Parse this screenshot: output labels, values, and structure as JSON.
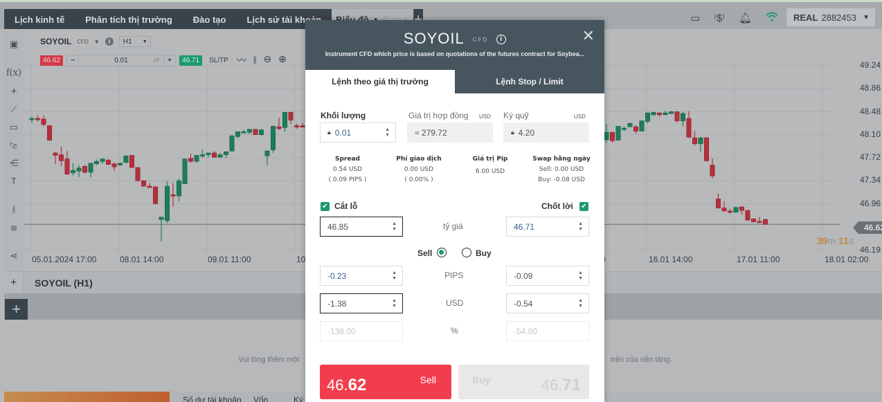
{
  "nav": {
    "tabs": [
      "Lịch kinh tế",
      "Phân tích thị trường",
      "Đào tạo",
      "Lịch sử tài khoản"
    ],
    "active_tab": "Biểu đồ",
    "active_tab_controls": "⧉ ▭ ×",
    "add_tab": "+"
  },
  "topbar": {
    "icons": [
      "layout-icon",
      "price-alert-icon",
      "bell-icon",
      "wifi-icon"
    ],
    "account_type": "REAL",
    "account_number": "2882453",
    "wifi_color": "#1d9a6c"
  },
  "chart_header": {
    "symbol": "SOYOIL",
    "symbol_type": "CFD",
    "timeframe": "H1",
    "sell_price": "46.62",
    "buy_price": "46.71",
    "volume": "0.01",
    "sltp_label": "SL/TP",
    "sell_color": "#d23a46",
    "buy_color": "#1d9a6c"
  },
  "chart_data": {
    "type": "candlestick",
    "symbol": "SOYOIL",
    "timeframe": "H1",
    "ylim": [
      46.0,
      49.4
    ],
    "yticks": [
      "49.24",
      "48.86",
      "48.48",
      "48.10",
      "47.72",
      "47.34",
      "46.96",
      "46.19"
    ],
    "current_price": "46.62",
    "countdown": {
      "minutes": "39",
      "m": "m",
      "seconds": "11",
      "s": "s"
    },
    "xticks": [
      {
        "label": "05.01.2024 17:00",
        "bar": 0
      },
      {
        "label": "08.01 14:00",
        "bar": 14
      },
      {
        "label": "09.01 11:00",
        "bar": 29
      },
      {
        "label": "10",
        "bar": 44
      },
      {
        "label": "0",
        "bar": 94
      },
      {
        "label": "16.01 14:00",
        "bar": 104
      },
      {
        "label": "17.01 11:00",
        "bar": 120
      },
      {
        "label": "18.01 02:00",
        "bar": 135
      }
    ],
    "candles_left": [
      {
        "o": 48.35,
        "h": 48.4,
        "l": 48.3,
        "c": 48.37
      },
      {
        "o": 48.37,
        "h": 48.42,
        "l": 48.32,
        "c": 48.35
      },
      {
        "o": 48.36,
        "h": 48.42,
        "l": 48.24,
        "c": 48.27
      },
      {
        "o": 48.25,
        "h": 48.26,
        "l": 48.0,
        "c": 48.01
      },
      {
        "o": 47.8,
        "h": 47.82,
        "l": 47.62,
        "c": 47.76
      },
      {
        "o": 47.77,
        "h": 47.9,
        "l": 47.58,
        "c": 47.67
      },
      {
        "o": 47.7,
        "h": 47.83,
        "l": 47.44,
        "c": 47.45
      },
      {
        "o": 47.47,
        "h": 47.63,
        "l": 47.43,
        "c": 47.51
      },
      {
        "o": 47.5,
        "h": 47.6,
        "l": 47.4,
        "c": 47.55
      },
      {
        "o": 47.58,
        "h": 47.6,
        "l": 47.46,
        "c": 47.48
      },
      {
        "o": 47.48,
        "h": 47.62,
        "l": 47.4,
        "c": 47.63
      },
      {
        "o": 47.62,
        "h": 47.69,
        "l": 47.6,
        "c": 47.66
      },
      {
        "o": 47.66,
        "h": 47.71,
        "l": 47.62,
        "c": 47.7
      },
      {
        "o": 47.68,
        "h": 47.7,
        "l": 47.6,
        "c": 47.61
      },
      {
        "o": 47.62,
        "h": 47.64,
        "l": 47.5,
        "c": 47.57
      },
      {
        "o": 47.6,
        "h": 47.64,
        "l": 47.58,
        "c": 47.63
      },
      {
        "o": 47.64,
        "h": 47.76,
        "l": 47.64,
        "c": 47.75
      },
      {
        "o": 47.76,
        "h": 47.76,
        "l": 47.55,
        "c": 47.56
      },
      {
        "o": 47.56,
        "h": 47.56,
        "l": 47.33,
        "c": 47.34
      },
      {
        "o": 47.34,
        "h": 47.35,
        "l": 47.25,
        "c": 47.25
      },
      {
        "o": 47.25,
        "h": 47.3,
        "l": 47.23,
        "c": 47.24
      },
      {
        "o": 47.24,
        "h": 47.25,
        "l": 46.95,
        "c": 46.96
      },
      {
        "o": 46.7,
        "h": 46.73,
        "l": 46.34,
        "c": 46.74
      },
      {
        "o": 46.68,
        "h": 47.33,
        "l": 46.64,
        "c": 47.25
      },
      {
        "o": 47.11,
        "h": 47.3,
        "l": 46.91,
        "c": 47.09
      },
      {
        "o": 47.09,
        "h": 47.38,
        "l": 47.0,
        "c": 47.34
      },
      {
        "o": 47.29,
        "h": 47.71,
        "l": 47.29,
        "c": 47.7
      },
      {
        "o": 47.71,
        "h": 47.79,
        "l": 47.64,
        "c": 47.66
      },
      {
        "o": 47.66,
        "h": 47.76,
        "l": 47.64,
        "c": 47.76
      },
      {
        "o": 47.75,
        "h": 47.85,
        "l": 47.72,
        "c": 47.77
      },
      {
        "o": 47.77,
        "h": 47.79,
        "l": 47.73,
        "c": 47.8
      },
      {
        "o": 47.8,
        "h": 47.83,
        "l": 47.72,
        "c": 47.73
      },
      {
        "o": 47.73,
        "h": 47.8,
        "l": 47.72,
        "c": 47.77
      },
      {
        "o": 47.77,
        "h": 47.79,
        "l": 47.72,
        "c": 47.82
      },
      {
        "o": 47.83,
        "h": 48.1,
        "l": 47.82,
        "c": 48.08
      },
      {
        "o": 48.07,
        "h": 48.15,
        "l": 48.04,
        "c": 48.15
      },
      {
        "o": 48.13,
        "h": 48.18,
        "l": 48.13,
        "c": 48.15
      },
      {
        "o": 48.14,
        "h": 48.19,
        "l": 48.11,
        "c": 48.19
      },
      {
        "o": 48.19,
        "h": 48.19,
        "l": 48.1,
        "c": 48.1
      },
      {
        "o": 48.1,
        "h": 48.2,
        "l": 48.09,
        "c": 48.18
      },
      {
        "o": 47.75,
        "h": 47.85,
        "l": 47.6,
        "c": 47.83
      },
      {
        "o": 47.85,
        "h": 48.25,
        "l": 47.8,
        "c": 48.24
      },
      {
        "o": 48.23,
        "h": 48.38,
        "l": 48.18,
        "c": 48.2
      },
      {
        "o": 48.22,
        "h": 48.47,
        "l": 48.15,
        "c": 48.47
      },
      {
        "o": 48.47,
        "h": 48.48,
        "l": 48.28,
        "c": 48.34
      },
      {
        "o": 48.25,
        "h": 48.28,
        "l": 48.2,
        "c": 48.23
      },
      {
        "o": 48.25,
        "h": 48.3,
        "l": 48.22,
        "c": 48.23
      }
    ],
    "candles_right": [
      {
        "o": 48.02,
        "h": 48.28,
        "l": 47.97,
        "c": 48.14
      },
      {
        "o": 48.14,
        "h": 48.15,
        "l": 47.97,
        "c": 48.0
      },
      {
        "o": 48.01,
        "h": 48.23,
        "l": 48.01,
        "c": 48.24
      },
      {
        "o": 48.19,
        "h": 48.23,
        "l": 48.16,
        "c": 48.21
      },
      {
        "o": 48.23,
        "h": 48.27,
        "l": 48.23,
        "c": 48.29
      },
      {
        "o": 48.23,
        "h": 48.26,
        "l": 48.12,
        "c": 48.16
      },
      {
        "o": 48.16,
        "h": 48.3,
        "l": 48.16,
        "c": 48.33
      },
      {
        "o": 48.32,
        "h": 48.47,
        "l": 48.29,
        "c": 48.46
      },
      {
        "o": 48.43,
        "h": 48.48,
        "l": 48.41,
        "c": 48.47
      },
      {
        "o": 48.46,
        "h": 48.47,
        "l": 48.4,
        "c": 48.43
      },
      {
        "o": 48.43,
        "h": 48.5,
        "l": 48.43,
        "c": 48.46
      },
      {
        "o": 48.45,
        "h": 48.49,
        "l": 48.45,
        "c": 48.48
      },
      {
        "o": 48.48,
        "h": 48.49,
        "l": 48.3,
        "c": 48.33
      },
      {
        "o": 48.33,
        "h": 48.48,
        "l": 48.24,
        "c": 48.45
      },
      {
        "o": 48.37,
        "h": 48.49,
        "l": 48.05,
        "c": 48.06
      },
      {
        "o": 48.05,
        "h": 48.16,
        "l": 47.92,
        "c": 47.95
      },
      {
        "o": 47.95,
        "h": 48.06,
        "l": 47.82,
        "c": 48.05
      },
      {
        "o": 48.05,
        "h": 48.06,
        "l": 47.66,
        "c": 47.67
      },
      {
        "o": 47.6,
        "h": 47.71,
        "l": 47.38,
        "c": 47.42
      },
      {
        "o": 47.04,
        "h": 47.13,
        "l": 46.88,
        "c": 46.89
      },
      {
        "o": 46.89,
        "h": 47.0,
        "l": 46.83,
        "c": 46.84
      },
      {
        "o": 46.84,
        "h": 46.88,
        "l": 46.8,
        "c": 46.82
      },
      {
        "o": 46.82,
        "h": 46.91,
        "l": 46.82,
        "c": 46.9
      },
      {
        "o": 46.91,
        "h": 46.91,
        "l": 46.78,
        "c": 46.85
      },
      {
        "o": 46.85,
        "h": 46.86,
        "l": 46.69,
        "c": 46.69
      },
      {
        "o": 46.71,
        "h": 46.72,
        "l": 46.66,
        "c": 46.66
      },
      {
        "o": 46.67,
        "h": 46.74,
        "l": 46.64,
        "c": 46.65
      },
      {
        "o": 46.7,
        "h": 46.71,
        "l": 46.62,
        "c": 46.62
      }
    ],
    "up_color": "#1e7d58",
    "down_color": "#b6303d"
  },
  "bottom": {
    "panel_title": "SOYOIL (H1)",
    "empty_message_left": "Vui lòng thêm một",
    "empty_message_right": "trên của nền tảng.",
    "account_stats": [
      "Số dư tài khoản",
      "Vốn",
      "Ký quỹ"
    ]
  },
  "modal": {
    "title": "SOYOIL",
    "title_type": "CFD",
    "description": "Instrument CFD which price is based on quotations of the futures contract for Soybea...",
    "tabs": [
      "Lệnh theo giá thị trường",
      "Lệnh Stop / Limit"
    ],
    "volume_label": "Khối lượng",
    "volume_value": "0.01",
    "contract_value_label": "Giá trị hợp đồng",
    "contract_value_unit": "USD",
    "contract_value": "≈ 279.72",
    "margin_label": "Ký quỹ",
    "margin_unit": "USD",
    "margin_value": "4.20",
    "stats": [
      {
        "title": "Spread",
        "line1": "0.54 USD",
        "line2": "( 0.09 PIPS )"
      },
      {
        "title": "Phí giao dịch",
        "line1": "0.00 USD",
        "line2": "( 0.00% )"
      },
      {
        "title": "Giá trị Pip",
        "line1": "6.00 USD",
        "line2": ""
      },
      {
        "title": "Swap hằng ngày",
        "line1": "Sell: 0.00 USD",
        "line2": "Buy: -0.08 USD"
      }
    ],
    "stop_loss_label": "Cắt lỗ",
    "take_profit_label": "Chốt lời",
    "stop_loss_checked": true,
    "take_profit_checked": true,
    "rate_label": "tỷ giá",
    "sl_rate": "46.85",
    "tp_rate": "46.71",
    "direction_options": [
      "Sell",
      "Buy"
    ],
    "direction_selected": "Sell",
    "pips_label": "PIPS",
    "sl_pips": "-0.23",
    "tp_pips": "-0.09",
    "usd_label": "USD",
    "sl_usd": "-1.38",
    "tp_usd": "-0.54",
    "pct_label": "%",
    "sl_pct": "-138.00",
    "tp_pct": "-54.00",
    "sell_button": {
      "label": "Sell",
      "price_main": "46.",
      "price_big": "62"
    },
    "buy_button": {
      "label": "Buy",
      "price_main": "46.",
      "price_big": "71"
    },
    "sell_color": "#f23d4c"
  }
}
